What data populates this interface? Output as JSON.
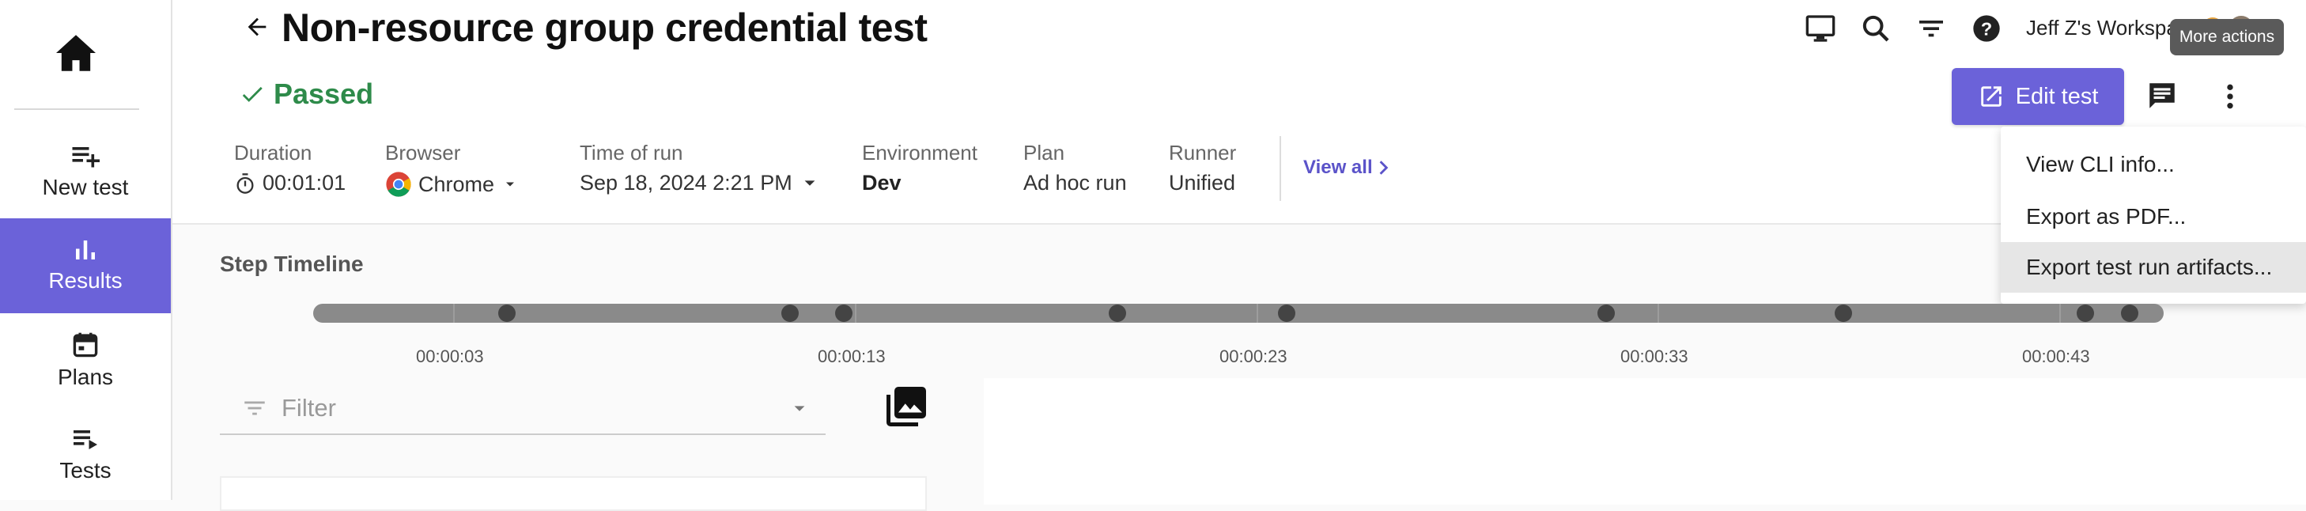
{
  "sidebar": {
    "home_icon": "home-icon",
    "items": [
      {
        "label": "New test",
        "icon": "playlist-add-icon"
      },
      {
        "label": "Results",
        "icon": "bar-chart-icon",
        "active": true
      },
      {
        "label": "Plans",
        "icon": "calendar-icon"
      },
      {
        "label": "Tests",
        "icon": "playlist-icon"
      }
    ]
  },
  "header": {
    "title": "Non-resource group credential test",
    "status": "Passed",
    "workspace": "Jeff Z's Workspa",
    "tooltip": "More actions",
    "edit_label": "Edit test"
  },
  "meta": {
    "duration": {
      "label": "Duration",
      "value": "00:01:01"
    },
    "browser": {
      "label": "Browser",
      "value": "Chrome"
    },
    "time_of_run": {
      "label": "Time of run",
      "value": "Sep 18, 2024 2:21 PM"
    },
    "environment": {
      "label": "Environment",
      "value": "Dev"
    },
    "plan": {
      "label": "Plan",
      "value": "Ad hoc run"
    },
    "runner": {
      "label": "Runner",
      "value": "Unified"
    },
    "view_all": "View all"
  },
  "menu": {
    "items": [
      "View CLI info...",
      "Export as PDF...",
      "Export test run artifacts..."
    ]
  },
  "timeline": {
    "title": "Step Timeline",
    "labels": [
      "00:00:03",
      "00:00:13",
      "00:00:23",
      "00:00:33",
      "00:00:43"
    ]
  },
  "filter": {
    "placeholder": "Filter"
  },
  "colors": {
    "accent": "#6b62d9",
    "passed": "#2e8b4a"
  }
}
